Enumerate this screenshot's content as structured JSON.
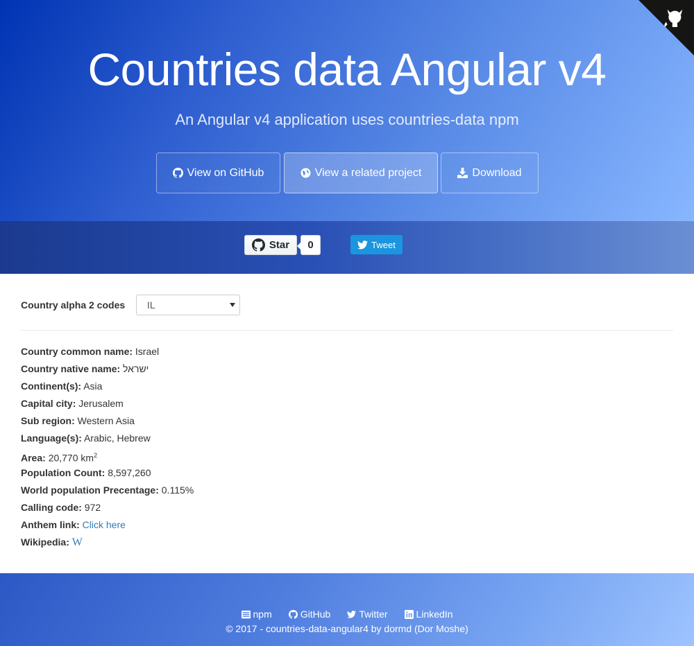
{
  "header": {
    "title": "Countries data Angular v4",
    "subtitle": "An Angular v4 application uses countries-data npm",
    "buttons": {
      "github": "View on GitHub",
      "related": "View a related project",
      "download": "Download"
    }
  },
  "social": {
    "star_label": "Star",
    "star_count": "0",
    "tweet_label": "Tweet"
  },
  "selector": {
    "label": "Country alpha 2 codes",
    "value": "IL"
  },
  "country": {
    "common_name_label": "Country common name:",
    "common_name": "Israel",
    "native_name_label": "Country native name:",
    "native_name": "ישראל",
    "continents_label": "Continent(s):",
    "continents": "Asia",
    "capital_label": "Capital city:",
    "capital": "Jerusalem",
    "subregion_label": "Sub region:",
    "subregion": "Western Asia",
    "languages_label": "Language(s):",
    "languages": "Arabic, Hebrew",
    "area_label": "Area:",
    "area": "20,770 km",
    "area_sup": "2",
    "population_label": "Population Count:",
    "population": "8,597,260",
    "world_pct_label": "World population Precentage:",
    "world_pct": "0.115%",
    "calling_code_label": "Calling code:",
    "calling_code": "972",
    "anthem_label": "Anthem link:",
    "anthem_link": "Click here",
    "wikipedia_label": "Wikipedia:",
    "wikipedia_glyph": "W"
  },
  "footer": {
    "links": {
      "npm": "npm",
      "github": "GitHub",
      "twitter": "Twitter",
      "linkedin": "LinkedIn"
    },
    "copyright": "© 2017 - countries-data-angular4 by dormd (Dor Moshe)"
  },
  "colors": {
    "hero_start": "#0033b3",
    "hero_end": "#88b6ff",
    "tweet_blue": "#1b95e0",
    "link_blue": "#337ab7"
  }
}
